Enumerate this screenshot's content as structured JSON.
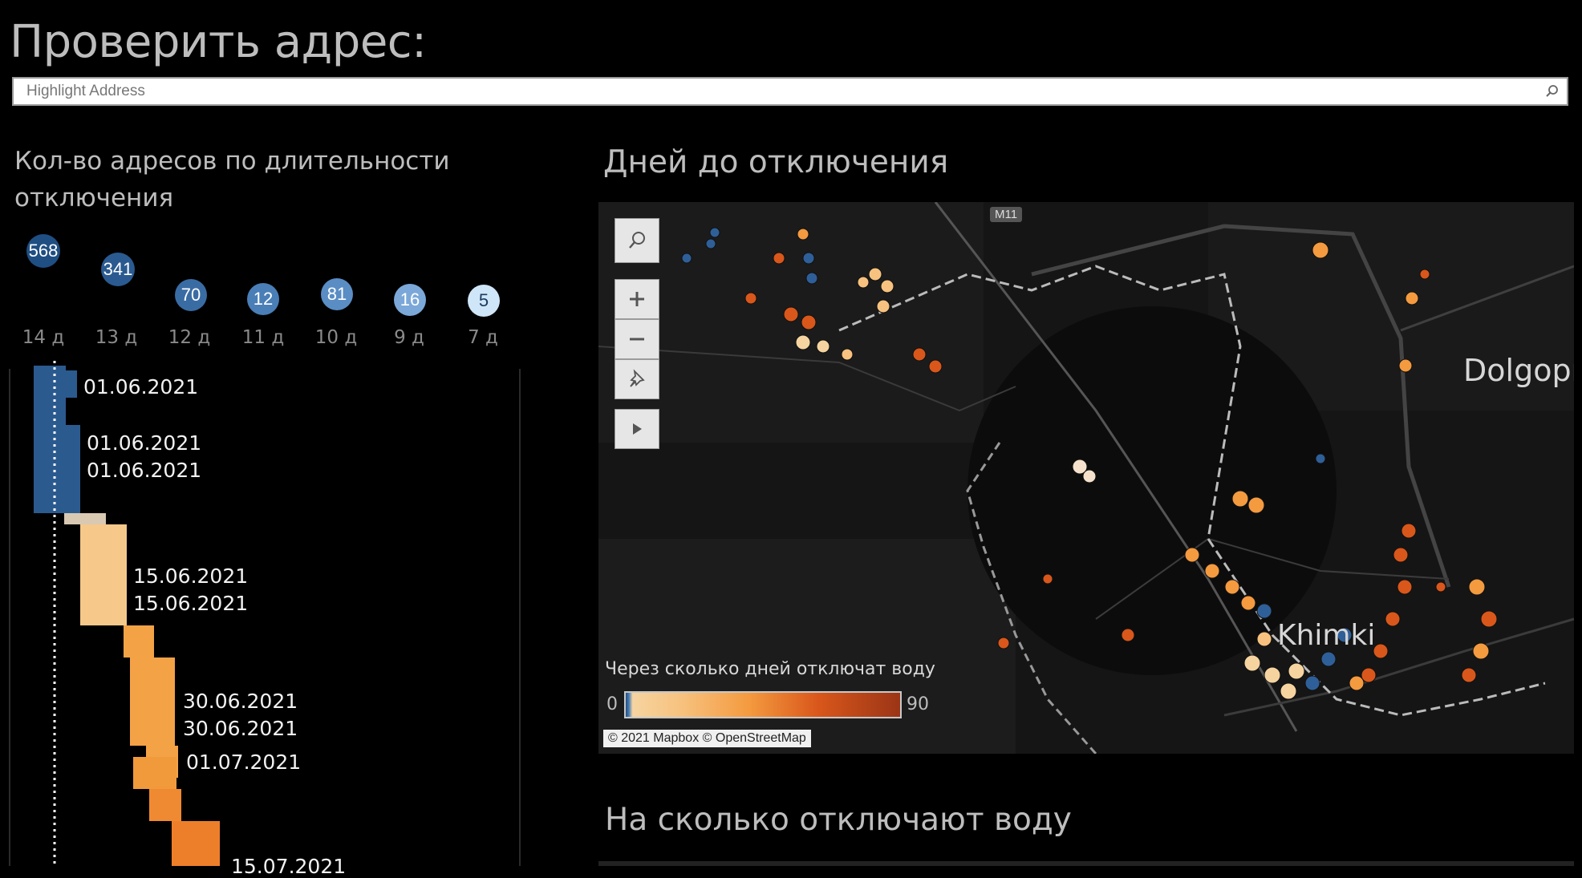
{
  "page": {
    "title": "Проверить адрес:",
    "search_placeholder": "Highlight Address"
  },
  "left_panel": {
    "title": "Кол-во адресов по длительности отключения",
    "counts": [
      {
        "days_label": "14 д",
        "count": "568",
        "color": "#1f4e82"
      },
      {
        "days_label": "13 д",
        "count": "341",
        "color": "#2a5a90"
      },
      {
        "days_label": "12 д",
        "count": "70",
        "color": "#3a6ca4"
      },
      {
        "days_label": "11 д",
        "count": "12",
        "color": "#4a7eb7"
      },
      {
        "days_label": "10 д",
        "count": "81",
        "color": "#5a8dc4"
      },
      {
        "days_label": "9 д",
        "count": "16",
        "color": "#7ba8d8"
      },
      {
        "days_label": "7 д",
        "count": "5",
        "color": "#cfe6f8"
      }
    ],
    "gantt_dates": [
      "01.06.2021",
      "01.06.2021",
      "01.06.2021",
      "15.06.2021",
      "15.06.2021",
      "30.06.2021",
      "30.06.2021",
      "01.07.2021",
      "15.07.2021"
    ]
  },
  "map": {
    "title": "Дней до отключения",
    "legend_title": "Через сколько дней отключат воду",
    "legend_min": "0",
    "legend_max": "90",
    "attribution": "© 2021 Mapbox © OpenStreetMap",
    "city_labels": [
      "Dolgopr",
      "Khimki"
    ],
    "road_shield": "M11",
    "controls": [
      "search-icon",
      "zoom-in-icon",
      "zoom-out-icon",
      "pin-icon",
      "play-icon"
    ]
  },
  "bottom": {
    "title": "На сколько отключают воду"
  },
  "colors": {
    "dark_blue": "#1f4e82",
    "light_tan": "#f6d4a0",
    "peach": "#f7c27f",
    "orange": "#f49a3f",
    "dark_orange": "#d9571b",
    "rust": "#9b3516"
  }
}
